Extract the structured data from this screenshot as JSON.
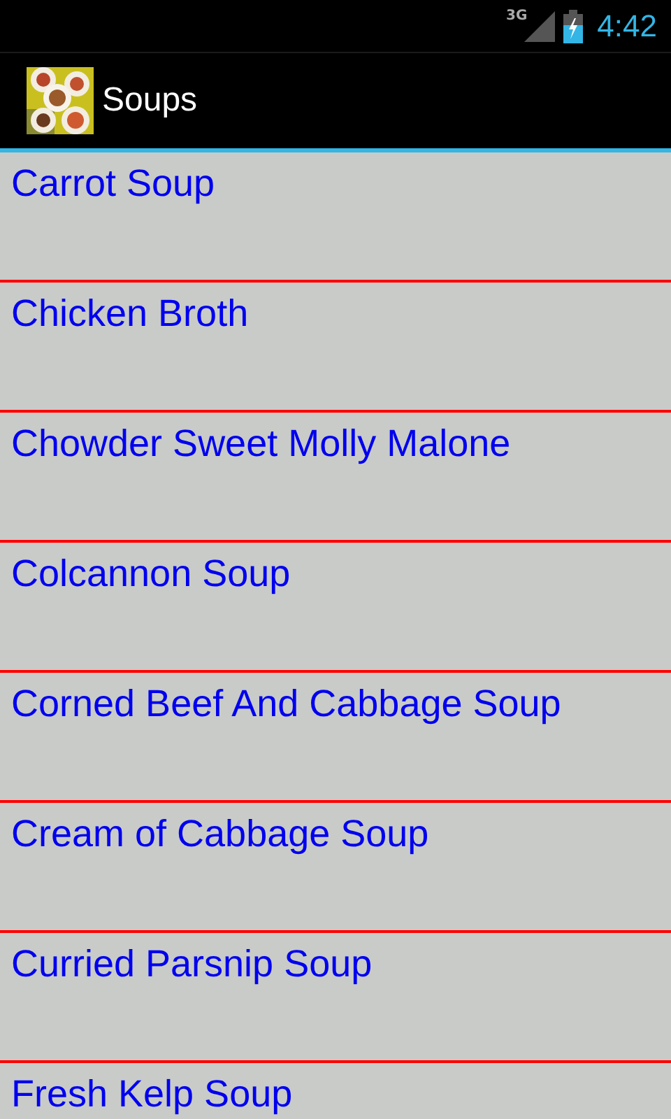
{
  "status_bar": {
    "network": "3G",
    "time": "4:42"
  },
  "action_bar": {
    "title": "Soups"
  },
  "items": [
    {
      "label": "Carrot Soup"
    },
    {
      "label": "Chicken Broth"
    },
    {
      "label": "Chowder Sweet Molly Malone"
    },
    {
      "label": "Colcannon Soup"
    },
    {
      "label": "Corned Beef And Cabbage Soup"
    },
    {
      "label": "Cream of Cabbage Soup"
    },
    {
      "label": "Curried Parsnip Soup"
    },
    {
      "label": "Fresh Kelp Soup"
    }
  ]
}
